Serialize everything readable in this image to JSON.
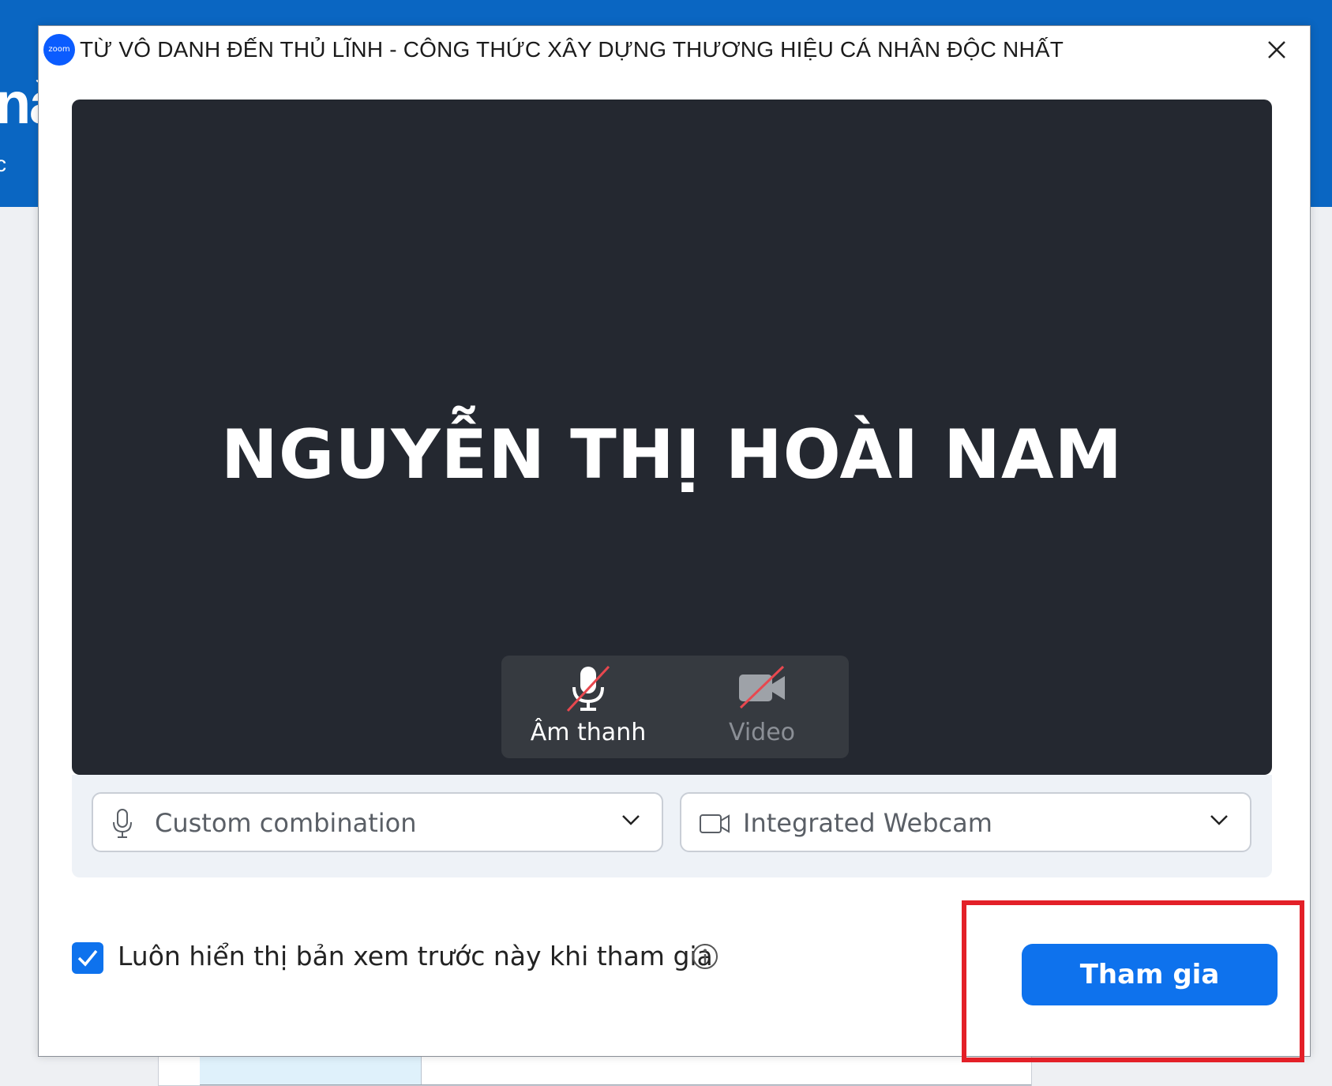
{
  "background": {
    "headline_fragment": "nà",
    "sub_fragment": "c"
  },
  "window": {
    "logo_text": "zoom",
    "title": "TỪ VÔ DANH ĐẾN THỦ LĨNH - CÔNG THỨC XÂY DỰNG THƯƠNG HIỆU CÁ NHÂN ĐỘC NHẤT"
  },
  "preview": {
    "participant_name": "NGUYỄN THỊ HOÀI NAM",
    "audio_label": "Âm thanh",
    "video_label": "Video"
  },
  "devices": {
    "microphone": "Custom combination",
    "camera": "Integrated Webcam"
  },
  "footer": {
    "always_show_preview_label": "Luôn hiển thị bản xem trước này khi tham gia",
    "always_show_preview_checked": true,
    "join_button": "Tham gia"
  },
  "colors": {
    "accent": "#0e72ed",
    "highlight": "#e32028",
    "preview_bg": "#242830",
    "muted_slash": "#e8484f"
  },
  "icons": {
    "close": "close-icon",
    "mic_muted": "microphone-off-icon",
    "video_off": "video-off-icon",
    "mic": "microphone-icon",
    "camera": "camera-icon",
    "chevron": "chevron-down-icon",
    "check": "check-icon",
    "info": "info-icon"
  }
}
